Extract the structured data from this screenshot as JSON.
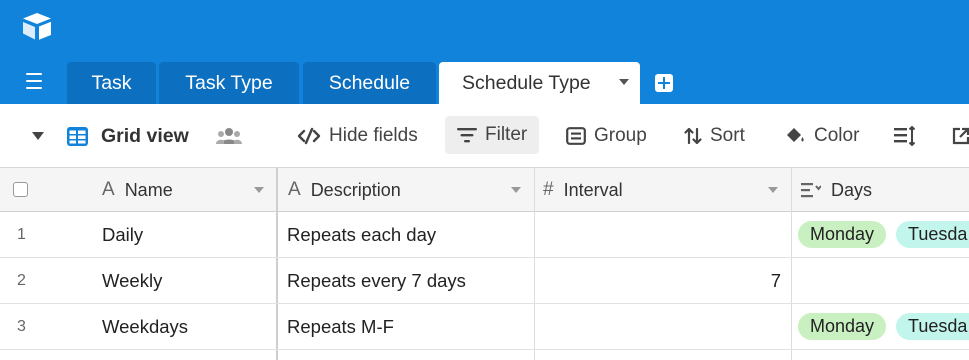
{
  "app": {
    "tabs": [
      {
        "label": "Task"
      },
      {
        "label": "Task Type"
      },
      {
        "label": "Schedule"
      },
      {
        "label": "Schedule Type",
        "active": true
      }
    ]
  },
  "toolbar": {
    "view_name": "Grid view",
    "hide_fields": "Hide fields",
    "filter": "Filter",
    "group": "Group",
    "sort": "Sort",
    "color": "Color"
  },
  "grid": {
    "columns": [
      {
        "label": "Name",
        "type_icon": "text-type-icon"
      },
      {
        "label": "Description",
        "type_icon": "text-type-icon"
      },
      {
        "label": "Interval",
        "type_icon": "number-type-icon"
      },
      {
        "label": "Days",
        "type_icon": "multiselect-type-icon"
      }
    ],
    "rows": [
      {
        "num": "1",
        "name": "Daily",
        "description": "Repeats each day",
        "interval": "",
        "days": [
          "Monday",
          "Tuesda"
        ]
      },
      {
        "num": "2",
        "name": "Weekly",
        "description": "Repeats every 7 days",
        "interval": "7",
        "days": []
      },
      {
        "num": "3",
        "name": "Weekdays",
        "description": "Repeats M-F",
        "interval": "",
        "days": [
          "Monday",
          "Tuesda"
        ]
      }
    ]
  },
  "colors": {
    "brand_blue": "#1283da",
    "chip_green": "#c8f0c0",
    "chip_teal": "#c2f5ec"
  }
}
